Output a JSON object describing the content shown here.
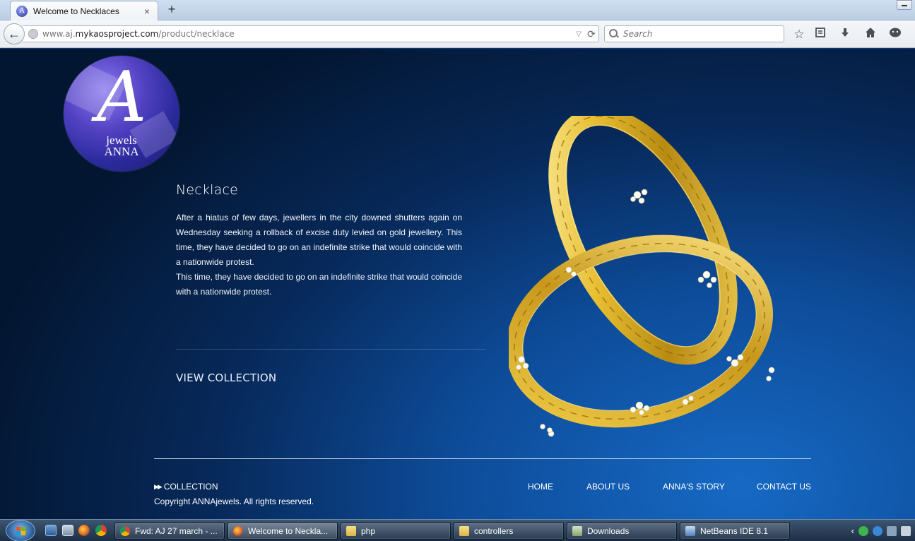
{
  "browser": {
    "tab_title": "Welcome to Necklaces",
    "new_tab_label": "+",
    "tab_close_label": "×",
    "url_domain_prefix": "www.aj.",
    "url_domain": "mykaosproject.com",
    "url_path": "/product/necklace",
    "search_placeholder": "Search",
    "toolbar_icons": [
      "bookmark-star-icon",
      "reading-list-icon",
      "download-icon",
      "home-icon",
      "hello-chat-icon"
    ]
  },
  "logo": {
    "letter": "A",
    "line1": "jewels",
    "line2": "ANNA"
  },
  "product": {
    "title": "Necklace",
    "description_p1": "After a hiatus of few days, jewellers in the city downed shutters again on Wednesday seeking a rollback of excise duty levied on gold jewellery. This time, they have decided to go on an indefinite strike that would coincide with a nationwide protest.",
    "description_p2": "This time, they have decided to go on an indefinite strike that would coincide with a nationwide protest.",
    "cta": "VIEW COLLECTION"
  },
  "footer": {
    "collection_label": "COLLECTION",
    "copyright": "Copyright ANNAjewels. All rights reserved.",
    "nav": [
      "HOME",
      "ABOUT US",
      "ANNA'S STORY",
      "CONTACT US"
    ]
  },
  "taskbar": {
    "items": [
      {
        "label": "Fwd: AJ 27 march - ...",
        "icon": "chrome-icon",
        "active": false
      },
      {
        "label": "Welcome to Neckla...",
        "icon": "firefox-icon",
        "active": true
      },
      {
        "label": "php",
        "icon": "folder-icon",
        "active": false
      },
      {
        "label": "controllers",
        "icon": "folder-icon",
        "active": false
      },
      {
        "label": "Downloads",
        "icon": "folder-icon",
        "active": false
      },
      {
        "label": "NetBeans IDE 8.1",
        "icon": "netbeans-icon",
        "active": false
      }
    ]
  },
  "colors": {
    "page_bg_dark": "#031631",
    "page_bg_light": "#1669c4",
    "gold": "#e0b52a"
  }
}
